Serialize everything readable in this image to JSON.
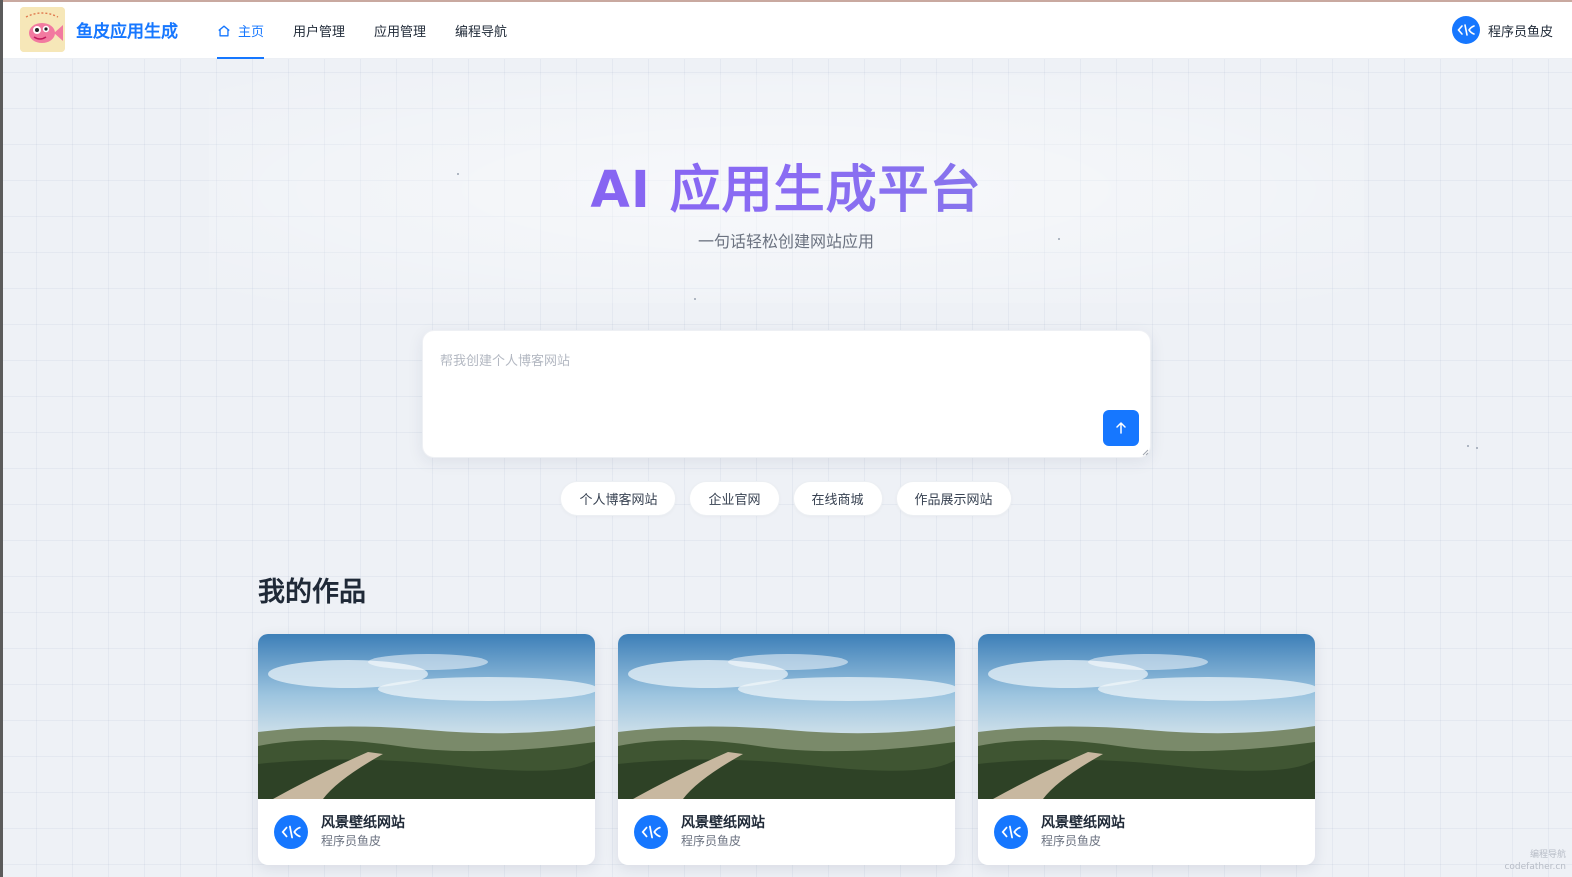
{
  "app": {
    "brand": "鱼皮应用生成"
  },
  "nav": {
    "items": [
      {
        "label": "主页",
        "icon": "home-icon",
        "active": true
      },
      {
        "label": "用户管理"
      },
      {
        "label": "应用管理"
      },
      {
        "label": "编程导航"
      }
    ]
  },
  "user": {
    "name": "程序员鱼皮",
    "avatar_icon": "code-fish-icon"
  },
  "hero": {
    "title": "AI 应用生成平台",
    "subtitle": "一句话轻松创建网站应用"
  },
  "prompt": {
    "value": "",
    "placeholder": "帮我创建个人博客网站",
    "send_icon": "arrow-up-icon"
  },
  "chips": [
    "个人博客网站",
    "企业官网",
    "在线商城",
    "作品展示网站"
  ],
  "works": {
    "title": "我的作品",
    "items": [
      {
        "title": "风景壁纸网站",
        "author": "程序员鱼皮"
      },
      {
        "title": "风景壁纸网站",
        "author": "程序员鱼皮"
      },
      {
        "title": "风景壁纸网站",
        "author": "程序员鱼皮"
      }
    ]
  },
  "watermark": {
    "line1": "编程导航",
    "line2": "codefather.cn"
  },
  "colors": {
    "accent": "#1677ff",
    "title_gradient_start": "#7b4df0",
    "title_gradient_end": "#7d8bd9"
  }
}
